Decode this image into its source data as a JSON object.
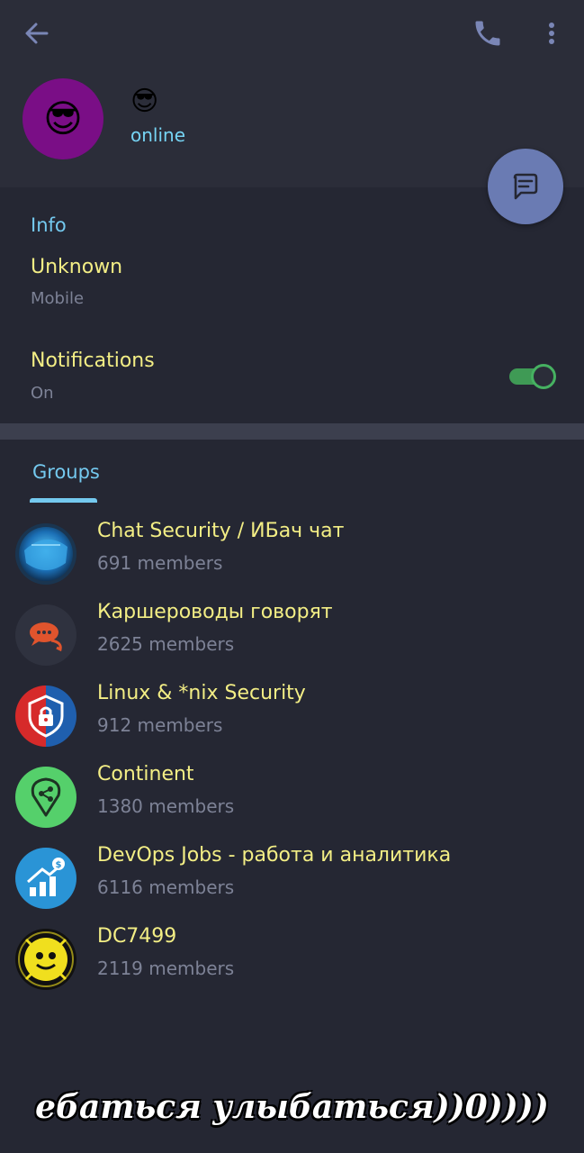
{
  "header": {
    "back_icon": "arrow-left-icon",
    "call_icon": "phone-icon",
    "menu_icon": "more-vertical-icon",
    "avatar_emoji": "😎",
    "name": "😎",
    "status": "online",
    "avatar_color": "#7a0e86",
    "fab_icon": "message-icon"
  },
  "info": {
    "section_title": "Info",
    "phone_value": "Unknown",
    "phone_label": "Mobile",
    "notifications_label": "Notifications",
    "notifications_value": "On",
    "notifications_enabled": true
  },
  "groups": {
    "tab_label": "Groups",
    "items": [
      {
        "name": "Chat Security / ИБач чат",
        "members": "691 members",
        "icon": "security-shield-icon"
      },
      {
        "name": "Каршероводы говорят",
        "members": "2625 members",
        "icon": "chat-bubbles-icon"
      },
      {
        "name": "Linux & *nix Security",
        "members": "912 members",
        "icon": "padlock-shield-icon"
      },
      {
        "name": "Continent",
        "members": "1380 members",
        "icon": "location-pin-icon"
      },
      {
        "name": "DevOps Jobs - работа и аналитика",
        "members": "6116 members",
        "icon": "growth-chart-icon"
      },
      {
        "name": "DC7499",
        "members": "2119 members",
        "icon": "defcon-skull-icon"
      }
    ]
  },
  "caption": "ебаться улыбаться))0))))",
  "colors": {
    "accent": "#74c9ef",
    "title_yellow": "#f3ee85",
    "toggle_green": "#46b161",
    "background": "#252733"
  }
}
